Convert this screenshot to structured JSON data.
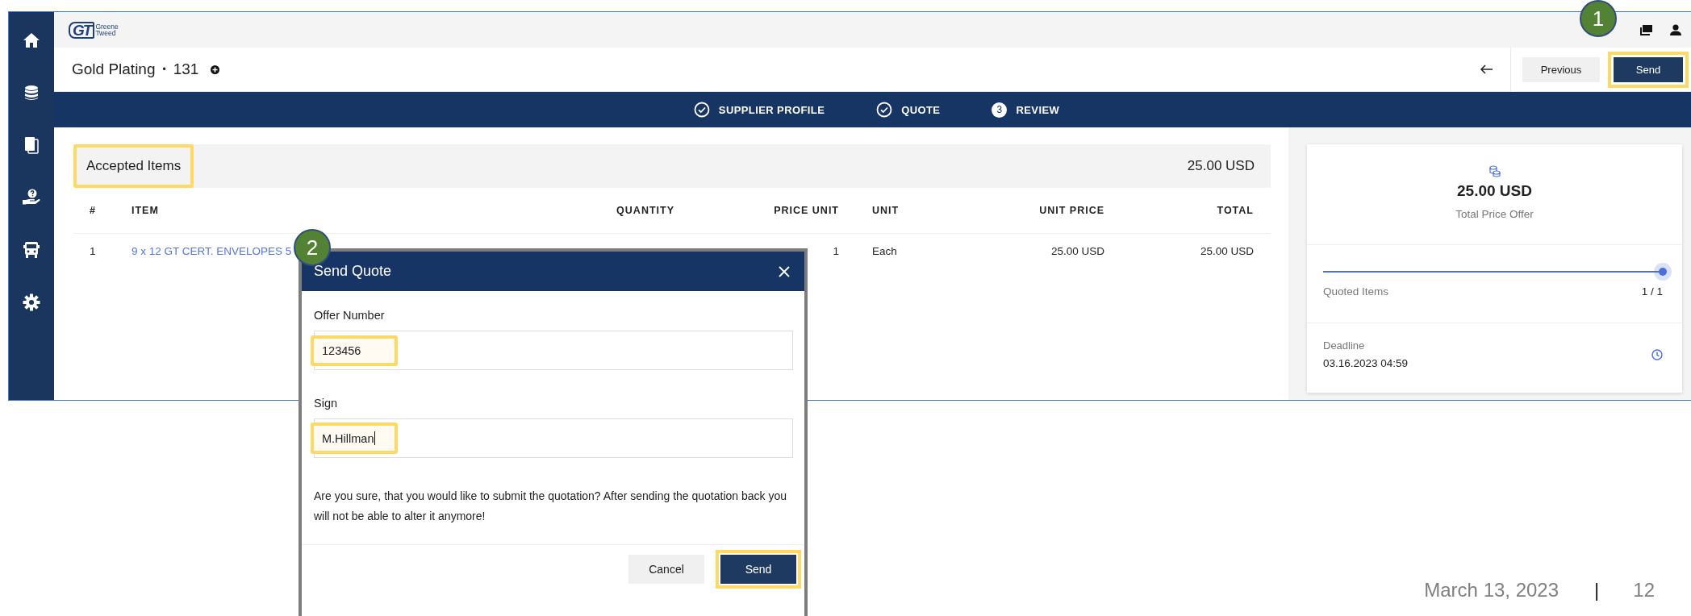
{
  "app": {
    "logo": {
      "mark": "GT",
      "name_lines": [
        "Greene",
        "Tweed"
      ]
    },
    "header": {
      "title": "Gold Plating",
      "separator": "•",
      "number": "131"
    },
    "actions": [
      {
        "label": "Previous",
        "kind": "secondary",
        "highlighted": false
      },
      {
        "label": "Send",
        "kind": "primary",
        "highlighted": true
      }
    ],
    "steps": [
      {
        "label": "SUPPLIER PROFILE",
        "done": true
      },
      {
        "label": "QUOTE",
        "done": true
      },
      {
        "label": "REVIEW",
        "done": false,
        "number": "3"
      }
    ],
    "accepted_items": {
      "title": "Accepted Items",
      "highlighted": true,
      "total": "25.00 USD",
      "columns": [
        "#",
        "ITEM",
        "QUANTITY",
        "PRICE UNIT",
        "UNIT",
        "UNIT PRICE",
        "TOTAL"
      ],
      "rows": [
        {
          "number": "1",
          "item": "9 x 12 GT CERT. ENVELOPES 5",
          "price_unit": "1",
          "unit": "Each",
          "unit_price": "25.00 USD",
          "total": "25.00 USD"
        }
      ]
    },
    "summary": {
      "total": "25.00 USD",
      "total_label": "Total Price Offer",
      "progress_label": "Quoted Items",
      "progress": "1 / 1",
      "level": 1,
      "deadline_label": "Deadline",
      "deadline": "03.16.2023 04:59"
    }
  },
  "dialog": {
    "title": "Send Quote",
    "fields": [
      {
        "label": "Offer Number",
        "value": "123456",
        "highlighted": true,
        "focused": false
      },
      {
        "label": "Sign",
        "value": "M.Hillman",
        "highlighted": true,
        "focused": true
      }
    ],
    "message": "Are you sure, that you would like to submit the quotation? After sending the quotation back you will not be able to alter it anymore!",
    "buttons": [
      {
        "label": "Cancel",
        "kind": "secondary",
        "highlighted": false
      },
      {
        "label": "Send",
        "kind": "primary",
        "highlighted": true
      }
    ]
  },
  "annotations": [
    {
      "number": "1"
    },
    {
      "number": "2"
    }
  ],
  "slide_footer": {
    "date": "March 13, 2023",
    "separator": "|",
    "page": "12"
  }
}
